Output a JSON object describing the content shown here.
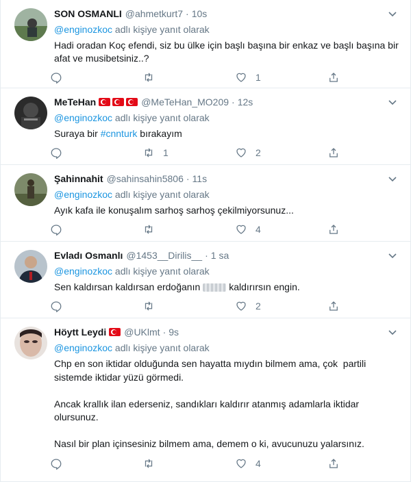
{
  "tweets": [
    {
      "name": "SON OSMANLI",
      "handle": "@ahmetkurt7",
      "time": "10s",
      "reply_prefix": "",
      "reply_handle": "@enginozkoc",
      "reply_suffix": " adlı kişiye yanıt olarak",
      "text": "Hadi oradan Koç efendi, siz bu ülke için başlı başına bir enkaz ve başlı başına bir afat ve musibetsiniz..?",
      "reply_count": "",
      "retweet_count": "",
      "like_count": "1"
    },
    {
      "name": "MeTeHan",
      "handle": "@MeTeHan_MO209",
      "time": "12s",
      "reply_handle": "@enginozkoc",
      "reply_suffix": " adlı kişiye yanıt olarak",
      "text_before": "Suraya bir ",
      "hashtag": "#cnnturk",
      "text_after": " bırakayım",
      "reply_count": "",
      "retweet_count": "1",
      "like_count": "2"
    },
    {
      "name": "Şahinnahit",
      "handle": "@sahinsahin5806",
      "time": "11s",
      "reply_handle": "@enginozkoc",
      "reply_suffix": " adlı kişiye yanıt olarak",
      "text": "Ayık kafa ile konuşalım sarhoş sarhoş çekilmiyorsunuz...",
      "reply_count": "",
      "retweet_count": "",
      "like_count": "4"
    },
    {
      "name": "Evladı Osmanlı",
      "handle": "@1453__Dirilis__",
      "time": "1 sa",
      "reply_handle": "@enginozkoc",
      "reply_suffix": " adlı kişiye yanıt olarak",
      "text_before": "Sen kaldırsan kaldırsan erdoğanın",
      "text_after": "kaldırırsın engin.",
      "reply_count": "",
      "retweet_count": "",
      "like_count": "2"
    },
    {
      "name": "Höytt Leydi",
      "handle": "@UKlmt",
      "time": "9s",
      "reply_handle": "@enginozkoc",
      "reply_suffix": " adlı kişiye yanıt olarak",
      "text": "Chp en son iktidar olduğunda sen hayatta mıydın bilmem ama, çok  partili sistemde iktidar yüzü görmedi.\n\nAncak krallık ilan ederseniz, sandıkları kaldırır atanmış adamlarla iktidar olursunuz.\n\nNasıl bir plan içinsesiniz bilmem ama, demem o ki, avucunuzu yalarsınız.",
      "reply_count": "",
      "retweet_count": "",
      "like_count": "4"
    }
  ],
  "icons": {
    "reply": "reply-icon",
    "retweet": "retweet-icon",
    "like": "heart-icon",
    "share": "share-icon",
    "caret": "chevron-down-icon"
  },
  "colors": {
    "link": "#1b95e0",
    "muted": "#657786",
    "text": "#14171a",
    "flag_red": "#e30a17"
  }
}
